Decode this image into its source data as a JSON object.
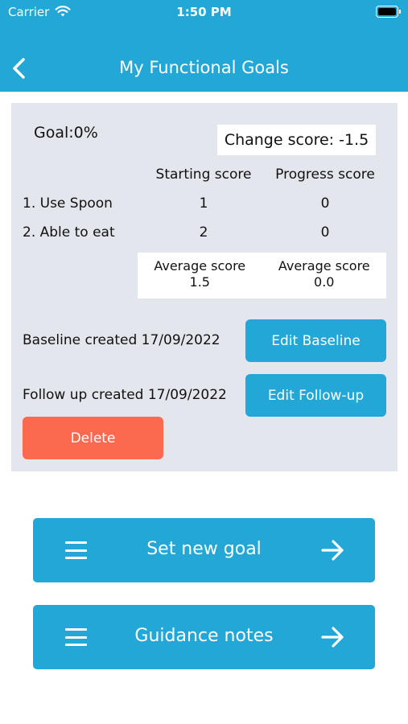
{
  "status_bar": {
    "carrier": "Carrier",
    "time": "1:50 PM",
    "icons": [
      "wifi-icon",
      "battery-icon"
    ]
  },
  "header": {
    "title": "My Functional Goals",
    "back_icon": "chevron-left-icon",
    "background_color": "#22a7d6"
  },
  "summary": {
    "goal_label": "Goal:0%",
    "change_score": "Change score: -1.5"
  },
  "table": {
    "columns": [
      "Starting score",
      "Progress score"
    ],
    "rows": [
      {
        "label": "1. Use Spoon",
        "starting": "1",
        "progress": "0"
      },
      {
        "label": "2. Able to eat",
        "starting": "2",
        "progress": "0"
      }
    ],
    "averages": {
      "starting_label": "Average score",
      "starting_value": "1.5",
      "progress_label": "Average score",
      "progress_value": "0.0"
    }
  },
  "baseline": {
    "created_text": "Baseline created 17/09/2022",
    "button_label": "Edit Baseline"
  },
  "followup": {
    "created_text": "Follow up created 17/09/2022",
    "button_label": "Edit Follow-up"
  },
  "delete": {
    "label": "Delete",
    "color": "#fb6a4f"
  },
  "actions": [
    {
      "label": "Set new goal",
      "icon_left": "menu-icon",
      "icon_right": "arrow-right-icon"
    },
    {
      "label": "Guidance notes",
      "icon_left": "menu-icon",
      "icon_right": "arrow-right-icon"
    }
  ],
  "colors": {
    "accent": "#22a7d6",
    "card_bg": "#e3e6ec"
  }
}
